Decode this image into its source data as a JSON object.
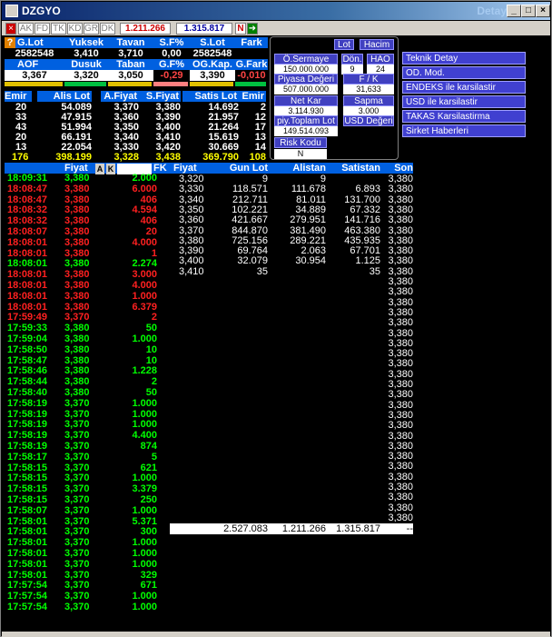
{
  "window": {
    "title": "DZGYO",
    "right_title": "Detay"
  },
  "toolbar": {
    "tabs": [
      "AK",
      "FD",
      "TK",
      "KD",
      "GR",
      "DK"
    ],
    "value1": "1.211.266",
    "value2": "1.315.817",
    "flag": "N"
  },
  "summary": {
    "row1_headers": [
      "G.Lot",
      "Yuksek",
      "Tavan",
      "S.F%",
      "S.Lot",
      "Fark"
    ],
    "row1_values": [
      "2582548",
      "3,410",
      "3,710",
      "0,00",
      "2582548",
      ""
    ],
    "row2_headers": [
      "AOF",
      "Dusuk",
      "Taban",
      "G.F%",
      "OG.Kap.",
      "G.Fark"
    ],
    "row2_values": [
      "3,367",
      "3,320",
      "3,050",
      "-0,29",
      "3,390",
      "-0,010"
    ]
  },
  "depth": {
    "headers": [
      "Emir",
      "Alis Lot",
      "A.Fiyat",
      "S.Fiyat",
      "Satis Lot",
      "Emir"
    ],
    "rows": [
      [
        "20",
        "54.089",
        "3,370",
        "3,380",
        "14.692",
        "2"
      ],
      [
        "33",
        "47.915",
        "3,360",
        "3,390",
        "21.957",
        "12"
      ],
      [
        "43",
        "51.994",
        "3,350",
        "3,400",
        "21.264",
        "17"
      ],
      [
        "20",
        "66.191",
        "3,340",
        "3,410",
        "15.619",
        "13"
      ],
      [
        "13",
        "22.054",
        "3,330",
        "3,420",
        "30.669",
        "14"
      ]
    ],
    "total": [
      "176",
      "398.199",
      "3,328",
      "3,438",
      "369.790",
      "108"
    ]
  },
  "info_panel": {
    "buttons": [
      "Lot",
      "Hacim"
    ],
    "labels": [
      "Ö.Sermaye",
      "Dön.",
      "HAO",
      "Piyasa Değeri",
      "F / K",
      "Net Kar",
      "Sapma",
      "piy.Toplam Lot",
      "USD Değeri",
      "Risk Kodu"
    ],
    "values": [
      "150.000.000",
      "9",
      "24",
      "507.000.000",
      "31,633",
      "3.114.930",
      "3.000",
      "149.514.093",
      "",
      "N"
    ]
  },
  "right_menu": [
    "Teknik Detay",
    "OD. Mod.",
    "ENDEKS ile karsilastir",
    "USD ile karsilastir",
    "TAKAS Karsilastirma",
    "Sirket Haberleri"
  ],
  "trades": {
    "headers": [
      "",
      "Fiyat",
      "",
      "FK"
    ],
    "filters": [
      "A",
      "K"
    ],
    "rows": [
      [
        "18:09:31",
        "3,380",
        "2.000",
        "g"
      ],
      [
        "18:08:47",
        "3,380",
        "6.000",
        "r"
      ],
      [
        "18:08:47",
        "3,380",
        "406",
        "r"
      ],
      [
        "18:08:32",
        "3,380",
        "4.594",
        "r"
      ],
      [
        "18:08:32",
        "3,380",
        "406",
        "r"
      ],
      [
        "18:08:07",
        "3,380",
        "20",
        "r"
      ],
      [
        "18:08:01",
        "3,380",
        "4.000",
        "r"
      ],
      [
        "18:08:01",
        "3,380",
        "1",
        "r"
      ],
      [
        "18:08:01",
        "3,380",
        "2.274",
        "g"
      ],
      [
        "18:08:01",
        "3,380",
        "3.000",
        "r"
      ],
      [
        "18:08:01",
        "3,380",
        "4.000",
        "r"
      ],
      [
        "18:08:01",
        "3,380",
        "1.000",
        "r"
      ],
      [
        "18:08:01",
        "3,380",
        "6.379",
        "r"
      ],
      [
        "17:59:49",
        "3,370",
        "2",
        "r"
      ],
      [
        "17:59:33",
        "3,380",
        "50",
        "g"
      ],
      [
        "17:59:04",
        "3,380",
        "1.000",
        "g"
      ],
      [
        "17:58:50",
        "3,380",
        "10",
        "g"
      ],
      [
        "17:58:47",
        "3,380",
        "10",
        "g"
      ],
      [
        "17:58:46",
        "3,380",
        "1.228",
        "g"
      ],
      [
        "17:58:44",
        "3,380",
        "2",
        "g"
      ],
      [
        "17:58:40",
        "3,380",
        "50",
        "g"
      ],
      [
        "17:58:19",
        "3,370",
        "1.000",
        "g"
      ],
      [
        "17:58:19",
        "3,370",
        "1.000",
        "g"
      ],
      [
        "17:58:19",
        "3,370",
        "1.000",
        "g"
      ],
      [
        "17:58:19",
        "3,370",
        "4.400",
        "g"
      ],
      [
        "17:58:19",
        "3,370",
        "874",
        "g"
      ],
      [
        "17:58:17",
        "3,370",
        "5",
        "g"
      ],
      [
        "17:58:15",
        "3,370",
        "621",
        "g"
      ],
      [
        "17:58:15",
        "3,370",
        "1.000",
        "g"
      ],
      [
        "17:58:15",
        "3,370",
        "3.379",
        "g"
      ],
      [
        "17:58:15",
        "3,370",
        "250",
        "g"
      ],
      [
        "17:58:07",
        "3,370",
        "1.000",
        "g"
      ],
      [
        "17:58:01",
        "3,370",
        "5.371",
        "g"
      ],
      [
        "17:58:01",
        "3,370",
        "300",
        "g"
      ],
      [
        "17:58:01",
        "3,370",
        "1.000",
        "g"
      ],
      [
        "17:58:01",
        "3,370",
        "1.000",
        "g"
      ],
      [
        "17:58:01",
        "3,370",
        "1.000",
        "g"
      ],
      [
        "17:58:01",
        "3,370",
        "329",
        "g"
      ],
      [
        "17:57:54",
        "3,370",
        "671",
        "g"
      ],
      [
        "17:57:54",
        "3,370",
        "1.000",
        "g"
      ],
      [
        "17:57:54",
        "3,370",
        "1.000",
        "g"
      ]
    ]
  },
  "price_dist": {
    "headers": [
      "Fiyat",
      "Gun Lot",
      "Alistan",
      "Satistan",
      "Son"
    ],
    "rows": [
      [
        "3,320",
        "9",
        "9",
        "",
        "3,380"
      ],
      [
        "3,330",
        "118.571",
        "111.678",
        "6.893",
        "3,380"
      ],
      [
        "3,340",
        "212.711",
        "81.011",
        "131.700",
        "3,380"
      ],
      [
        "3,350",
        "102.221",
        "34.889",
        "67.332",
        "3,380"
      ],
      [
        "3,360",
        "421.667",
        "279.951",
        "141.716",
        "3,380"
      ],
      [
        "3,370",
        "844.870",
        "381.490",
        "463.380",
        "3,380"
      ],
      [
        "3,380",
        "725.156",
        "289.221",
        "435.935",
        "3,380"
      ],
      [
        "3,390",
        "69.764",
        "2.063",
        "67.701",
        "3,380"
      ],
      [
        "3,400",
        "32.079",
        "30.954",
        "1.125",
        "3,380"
      ],
      [
        "3,410",
        "35",
        "",
        "35",
        "3,380"
      ]
    ],
    "extra_son_count": 25,
    "extra_son_value": "3,380",
    "total": [
      "",
      "2.527.083",
      "1.211.266",
      "1.315.817",
      "--"
    ]
  }
}
